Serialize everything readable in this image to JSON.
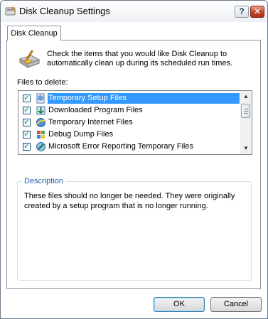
{
  "window": {
    "title": "Disk Cleanup Settings",
    "help_label": "?",
    "close_label": "✕"
  },
  "tabs": [
    {
      "label": "Disk Cleanup"
    }
  ],
  "intro": "Check the items that you would like Disk Cleanup to automatically clean up during its scheduled run times.",
  "files": {
    "label": "Files to delete:",
    "items": [
      {
        "label": "Temporary Setup Files",
        "checked": true
      },
      {
        "label": "Downloaded Program Files",
        "checked": true
      },
      {
        "label": "Temporary Internet Files",
        "checked": true
      },
      {
        "label": "Debug Dump Files",
        "checked": true
      },
      {
        "label": "Microsoft Error Reporting Temporary Files",
        "checked": true
      }
    ],
    "check_mark": "✓"
  },
  "description": {
    "legend": "Description",
    "text": "These files should no longer be needed. They were originally created by a setup program that is no longer running."
  },
  "buttons": {
    "ok": "OK",
    "cancel": "Cancel"
  }
}
